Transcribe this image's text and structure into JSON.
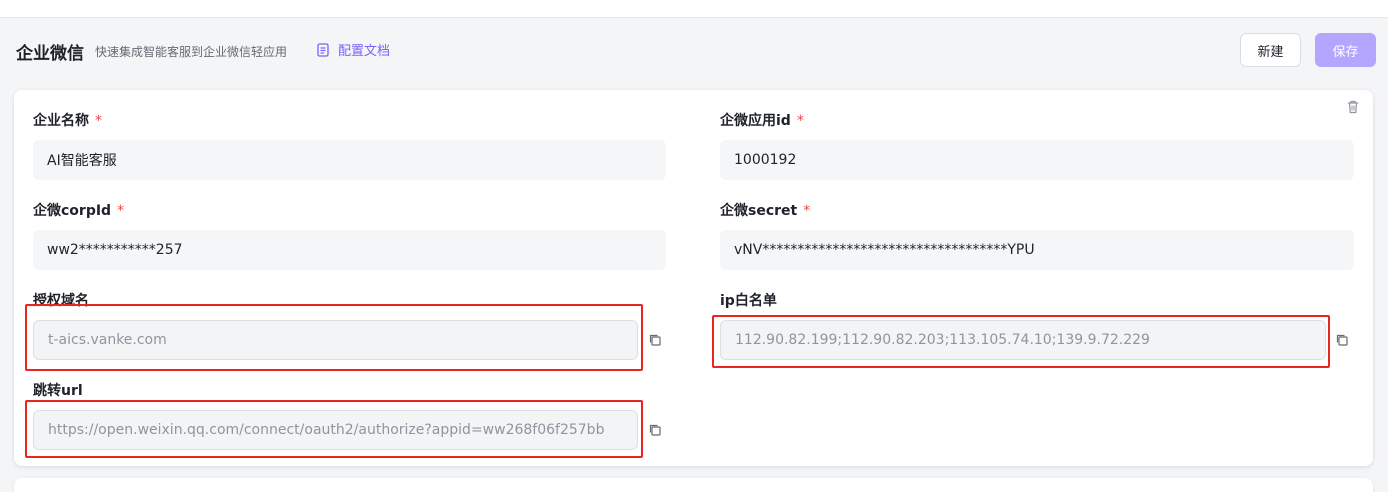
{
  "header": {
    "title": "企业微信",
    "subtitle": "快速集成智能客服到企业微信轻应用",
    "doc_link": "配置文档",
    "new_button": "新建",
    "save_button": "保存"
  },
  "form": {
    "corp_name": {
      "label": "企业名称",
      "required": "*",
      "value": "AI智能客服"
    },
    "app_id": {
      "label": "企微应用id",
      "required": "*",
      "value": "1000192"
    },
    "corp_id": {
      "label": "企微corpId",
      "required": "*",
      "value": "ww2***********257"
    },
    "secret": {
      "label": "企微secret",
      "required": "*",
      "value": "vNV***********************************YPU"
    },
    "auth_domain": {
      "label": "授权域名",
      "value": "t-aics.vanke.com"
    },
    "ip_whitelist": {
      "label": "ip白名单",
      "value": "112.90.82.199;112.90.82.203;113.105.74.10;139.9.72.229"
    },
    "redirect_url": {
      "label": "跳转url",
      "value": "https://open.weixin.qq.com/connect/oauth2/authorize?appid=ww268f06f257bb"
    }
  },
  "colors": {
    "accent": "#7b61ff",
    "save_disabled": "#b4a5ff",
    "required": "#e5484d",
    "highlight": "#e8261f"
  }
}
